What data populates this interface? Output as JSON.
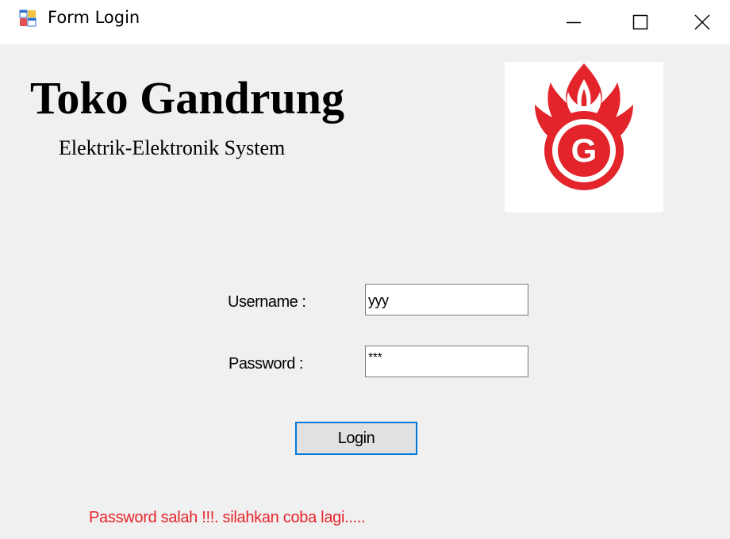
{
  "window": {
    "title": "Form Login",
    "icon": "winforms-form-icon"
  },
  "header": {
    "app_name": "Toko Gandrung",
    "subtitle": "Elektrik-Elektronik System",
    "logo": {
      "icon": "flame-g-logo",
      "letter": "G",
      "color": "#e3242b"
    }
  },
  "form": {
    "username_label": "Username :",
    "username_value": "yyy",
    "password_label": "Password :",
    "password_value": "***",
    "login_label": "Login"
  },
  "status": {
    "error_message": "Password salah !!!. silahkan coba lagi.....",
    "error_color": "#e8242c"
  },
  "colors": {
    "focus_border": "#0078d7",
    "client_background": "#f0f0f0"
  }
}
